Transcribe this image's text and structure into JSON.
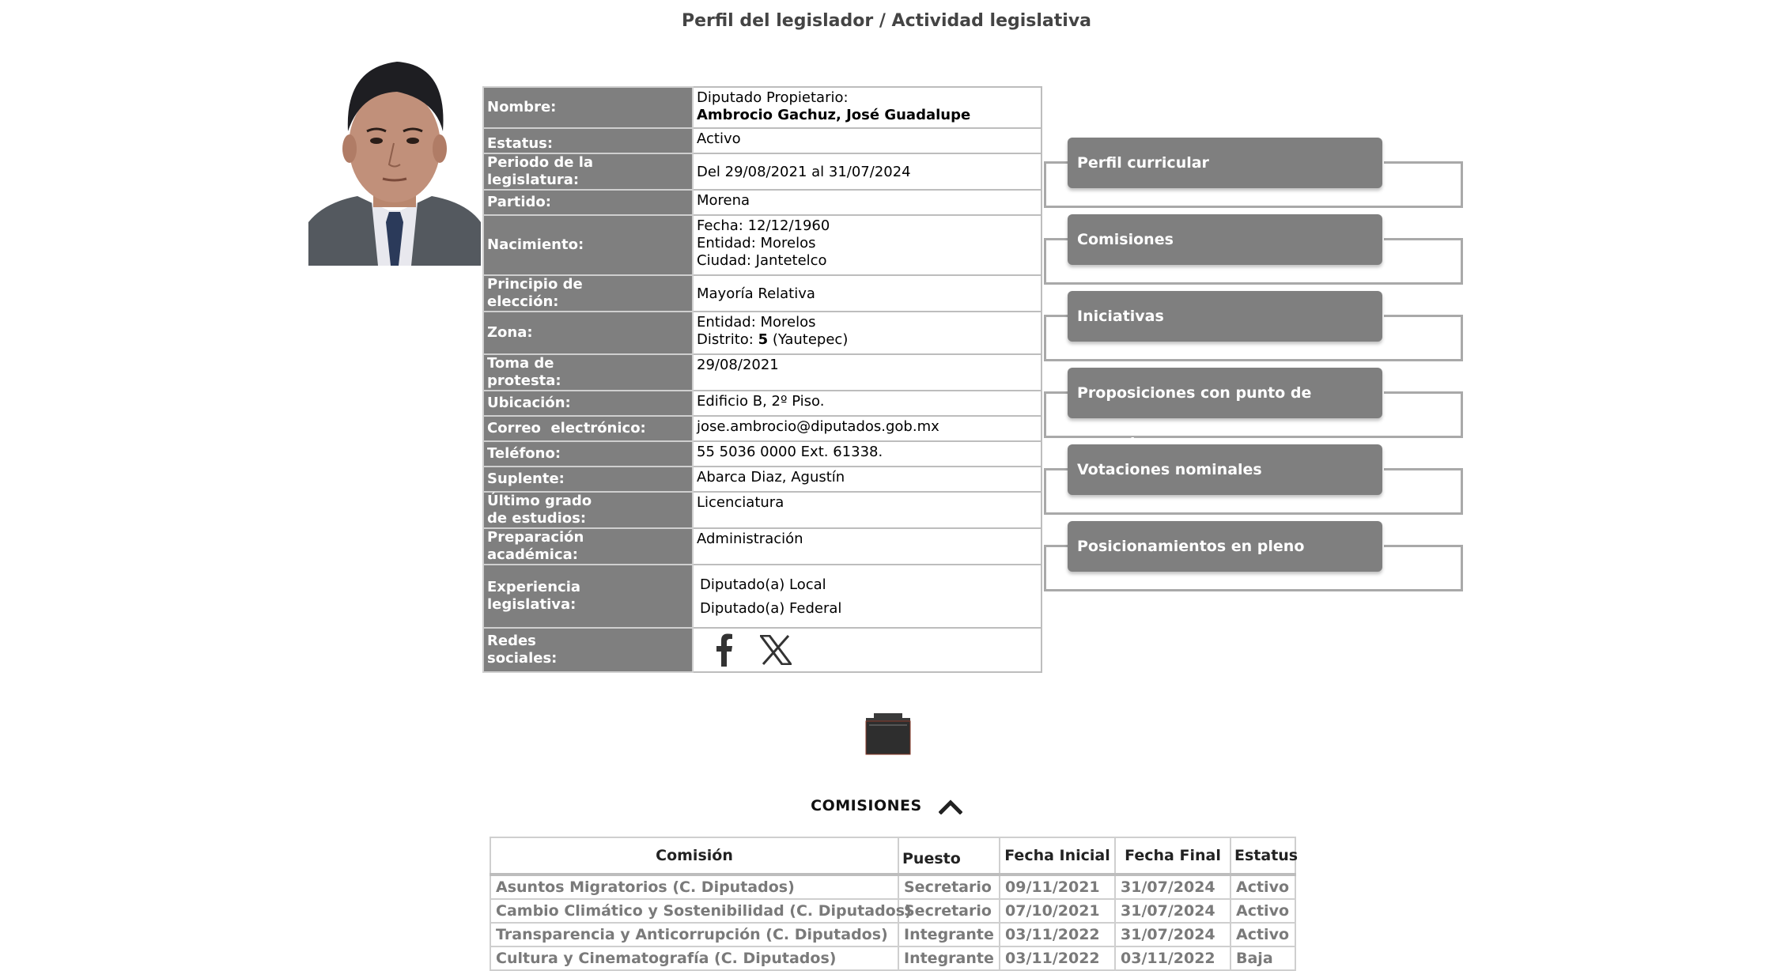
{
  "page": {
    "title": "Perfil del legislador / Actividad legislativa"
  },
  "profile": {
    "labels": {
      "nombre": "Nombre:",
      "estatus": "Estatus:",
      "periodo_1": "Periodo de la",
      "periodo_2": "legislatura:",
      "partido": "Partido:",
      "nacimiento": "Nacimiento:",
      "principio_1": "Principio de",
      "principio_2": "elección:",
      "zona": "Zona:",
      "toma_1": "Toma de",
      "toma_2": "protesta:",
      "ubicacion": "Ubicación:",
      "correo": "Correo  electrónico:",
      "telefono": "Teléfono:",
      "suplente": "Suplente:",
      "grado_1": "Último grado",
      "grado_2": "de estudios:",
      "preparacion_1": "Preparación",
      "preparacion_2": "académica:",
      "experiencia_1": "Experiencia",
      "experiencia_2": "legislativa:",
      "redes_1": "Redes",
      "redes_2": "sociales:"
    },
    "values": {
      "cargo": "Diputado Propietario:",
      "nombre": "Ambrocio Gachuz, José Guadalupe",
      "estatus": "Activo",
      "periodo": "Del 29/08/2021 al 31/07/2024",
      "partido": "Morena",
      "fecha_nacimiento": "Fecha: 12/12/1960",
      "entidad_nacimiento": "Entidad: Morelos",
      "ciudad_nacimiento": "Ciudad: Jantetelco",
      "principio": "Mayoría Relativa",
      "zona_entidad": "Entidad: Morelos",
      "distrito_label": "Distrito: ",
      "distrito_num": "5",
      "distrito_nombre": " (Yautepec)",
      "toma_protesta": "29/08/2021",
      "ubicacion": "Edificio B, 2º Piso.",
      "correo": "jose.ambrocio@diputados.gob.mx",
      "telefono": "55 5036 0000 Ext. 61338.",
      "suplente": "Abarca Diaz, Agustín",
      "grado": "Licenciatura",
      "preparacion": "Administración",
      "experiencia": [
        "Diputado(a) Local",
        "Diputado(a) Federal"
      ]
    },
    "social_icons": [
      "facebook-icon",
      "x-icon"
    ]
  },
  "menu": [
    "Perfil curricular",
    "Comisiones",
    "Iniciativas",
    "Proposiciones con punto de acuerdo",
    "Votaciones nominales",
    "Posicionamientos en pleno"
  ],
  "commissions_section": {
    "title": "COMISIONES",
    "headers": [
      "Comisión",
      "Puesto",
      "Fecha Inicial",
      "Fecha Final",
      "Estatus"
    ],
    "rows": [
      [
        "Asuntos Migratorios (C. Diputados)",
        "Secretario",
        "09/11/2021",
        "31/07/2024",
        "Activo"
      ],
      [
        "Cambio Climático y Sostenibilidad (C. Diputados)",
        "Secretario",
        "07/10/2021",
        "31/07/2024",
        "Activo"
      ],
      [
        "Transparencia y Anticorrupción (C. Diputados)",
        "Integrante",
        "03/11/2022",
        "31/07/2024",
        "Activo"
      ],
      [
        "Cultura y Cinematografía (C. Diputados)",
        "Integrante",
        "03/11/2022",
        "03/11/2022",
        "Baja"
      ]
    ]
  },
  "colors": {
    "label_bg": "#7f7f7f",
    "menu_bg": "#7f7f7f",
    "border": "#bdbdbd"
  }
}
